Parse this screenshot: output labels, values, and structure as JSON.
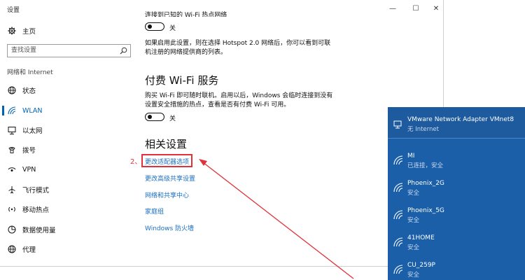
{
  "window": {
    "title": "设置",
    "min": "—",
    "max": "☐",
    "close": "✕"
  },
  "sidebar": {
    "home": "主页",
    "search_placeholder": "查找设置",
    "group": "网络和 Internet",
    "items": [
      {
        "label": "状态",
        "icon": "globe-icon"
      },
      {
        "label": "WLAN",
        "icon": "wifi-icon"
      },
      {
        "label": "以太网",
        "icon": "ethernet-icon"
      },
      {
        "label": "拨号",
        "icon": "phone-icon"
      },
      {
        "label": "VPN",
        "icon": "vpn-icon"
      },
      {
        "label": "飞行模式",
        "icon": "airplane-icon"
      },
      {
        "label": "移动热点",
        "icon": "hotspot-icon"
      },
      {
        "label": "数据使用量",
        "icon": "data-usage-icon"
      },
      {
        "label": "代理",
        "icon": "globe-icon"
      }
    ],
    "active_index": 1
  },
  "content": {
    "cut_text": "连接到已知的 Wi-Fi 热点网络",
    "toggle1_label": "关",
    "hotspot_para": "如果启用此设置，则在选择 Hotspot 2.0 网络后，你可以看到可联机注册的网络提供商的列表。",
    "paid_heading": "付费 Wi-Fi 服务",
    "paid_para": "购买 Wi-Fi 即可随时联机。启用以后，Windows 会临时连接到没有设置安全措施的热点，查看是否有付费 Wi-Fi 可用。",
    "toggle2_label": "关",
    "related_heading": "相关设置",
    "links": [
      "更改适配器选项",
      "更改高级共享设置",
      "网络和共享中心",
      "家庭组",
      "Windows 防火墙"
    ],
    "annotation": "2、"
  },
  "flyout": {
    "adapter": {
      "name": "VMware Network Adapter VMnet8",
      "status": "无 Internet"
    },
    "networks": [
      {
        "name": "MI",
        "status": "已连接，安全"
      },
      {
        "name": "Phoenix_2G",
        "status": "安全"
      },
      {
        "name": "Phoenix_5G",
        "status": "安全"
      },
      {
        "name": "41HOME",
        "status": "安全"
      },
      {
        "name": "CU_259P",
        "status": "安全"
      }
    ]
  },
  "colors": {
    "accent": "#0063b1",
    "link": "#1a6fc1",
    "annotation_red": "#e0323a",
    "flyout_bg": "#1b5fa8"
  }
}
